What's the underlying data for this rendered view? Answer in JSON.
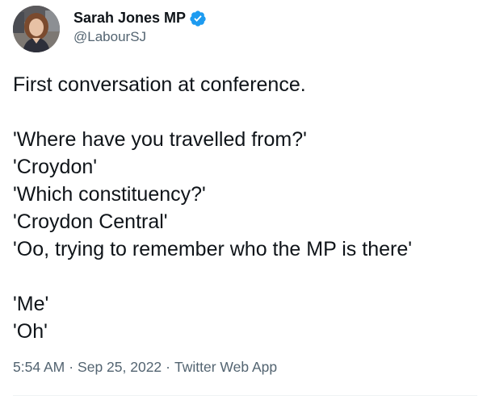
{
  "author": {
    "display_name": "Sarah Jones MP",
    "handle": "@LabourSJ",
    "verified_icon": "verified-badge-icon",
    "verified_color": "#1d9bf0"
  },
  "tweet": {
    "lines": [
      "First conversation at conference.",
      "",
      "'Where have you travelled from?'",
      "'Croydon'",
      "'Which constituency?'",
      "'Croydon Central'",
      "'Oo, trying to remember who the MP is there'",
      "",
      "'Me'",
      "'Oh'"
    ]
  },
  "meta": {
    "time": "5:54 AM",
    "separator": "·",
    "date": "Sep 25, 2022",
    "source": "Twitter Web App"
  },
  "colors": {
    "text_primary": "#0f1419",
    "text_secondary": "#536471",
    "divider": "#eff3f4"
  }
}
